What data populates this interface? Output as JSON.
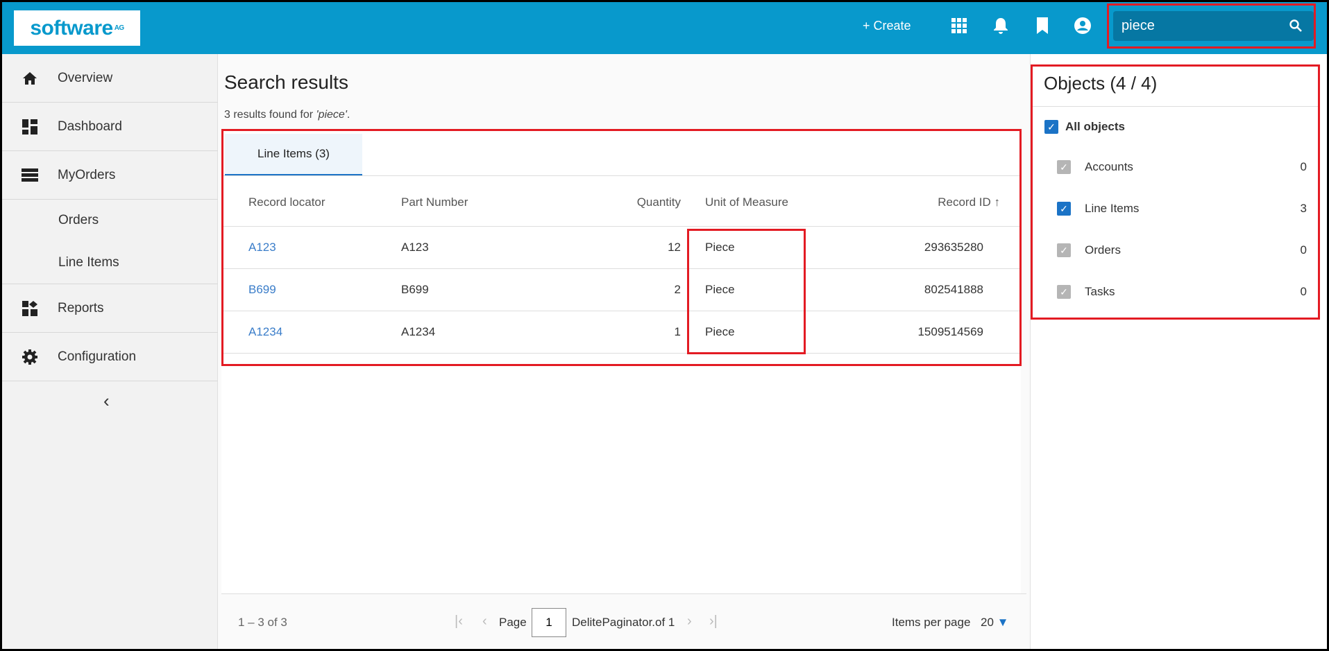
{
  "header": {
    "logo_text": "software",
    "logo_sup": "AG",
    "create_label": "+ Create",
    "search_value": "piece",
    "icons": [
      "apps-grid-icon",
      "bell-icon",
      "bookmark-icon",
      "account-circle-icon",
      "search-icon"
    ]
  },
  "sidebar": {
    "items": [
      {
        "label": "Overview",
        "icon": "home-icon"
      },
      {
        "label": "Dashboard",
        "icon": "dashboard-icon"
      },
      {
        "label": "MyOrders",
        "icon": "list-icon"
      },
      {
        "label": "Orders"
      },
      {
        "label": "Line Items"
      },
      {
        "label": "Reports",
        "icon": "reports-icon"
      },
      {
        "label": "Configuration",
        "icon": "gear-icon"
      }
    ],
    "collapse": "‹"
  },
  "main": {
    "title": "Search results",
    "subtitle_prefix": "3 results found for ",
    "subtitle_query": "'piece'",
    "subtitle_suffix": ".",
    "tab": "Line Items (3)",
    "columns": [
      "Record locator",
      "Part Number",
      "Quantity",
      "Unit of Measure",
      "Record ID"
    ],
    "sort_indicator": "↑",
    "rows": [
      [
        "A123",
        "A123",
        "12",
        "Piece",
        "293635280"
      ],
      [
        "B699",
        "B699",
        "2",
        "Piece",
        "802541888"
      ],
      [
        "A1234",
        "A1234",
        "1",
        "Piece",
        "1509514569"
      ]
    ],
    "paginator": {
      "range": "1 – 3 of 3",
      "page_label": "Page",
      "page": "1",
      "of_label": "DelitePaginator.of 1",
      "items_per_page_label": "Items per page",
      "items_per_page": "20"
    }
  },
  "objects": {
    "title": "Objects (4 / 4)",
    "all_label": "All objects",
    "items": [
      {
        "label": "Accounts",
        "count": "0",
        "checked": "disabled"
      },
      {
        "label": "Line Items",
        "count": "3",
        "checked": "on"
      },
      {
        "label": "Orders",
        "count": "0",
        "checked": "disabled"
      },
      {
        "label": "Tasks",
        "count": "0",
        "checked": "disabled"
      }
    ]
  },
  "colors": {
    "header": "#0899cc",
    "search": "#0677a3",
    "accent": "#1b73c6",
    "link": "#3a7dc9",
    "highlight": "#e31b23"
  }
}
